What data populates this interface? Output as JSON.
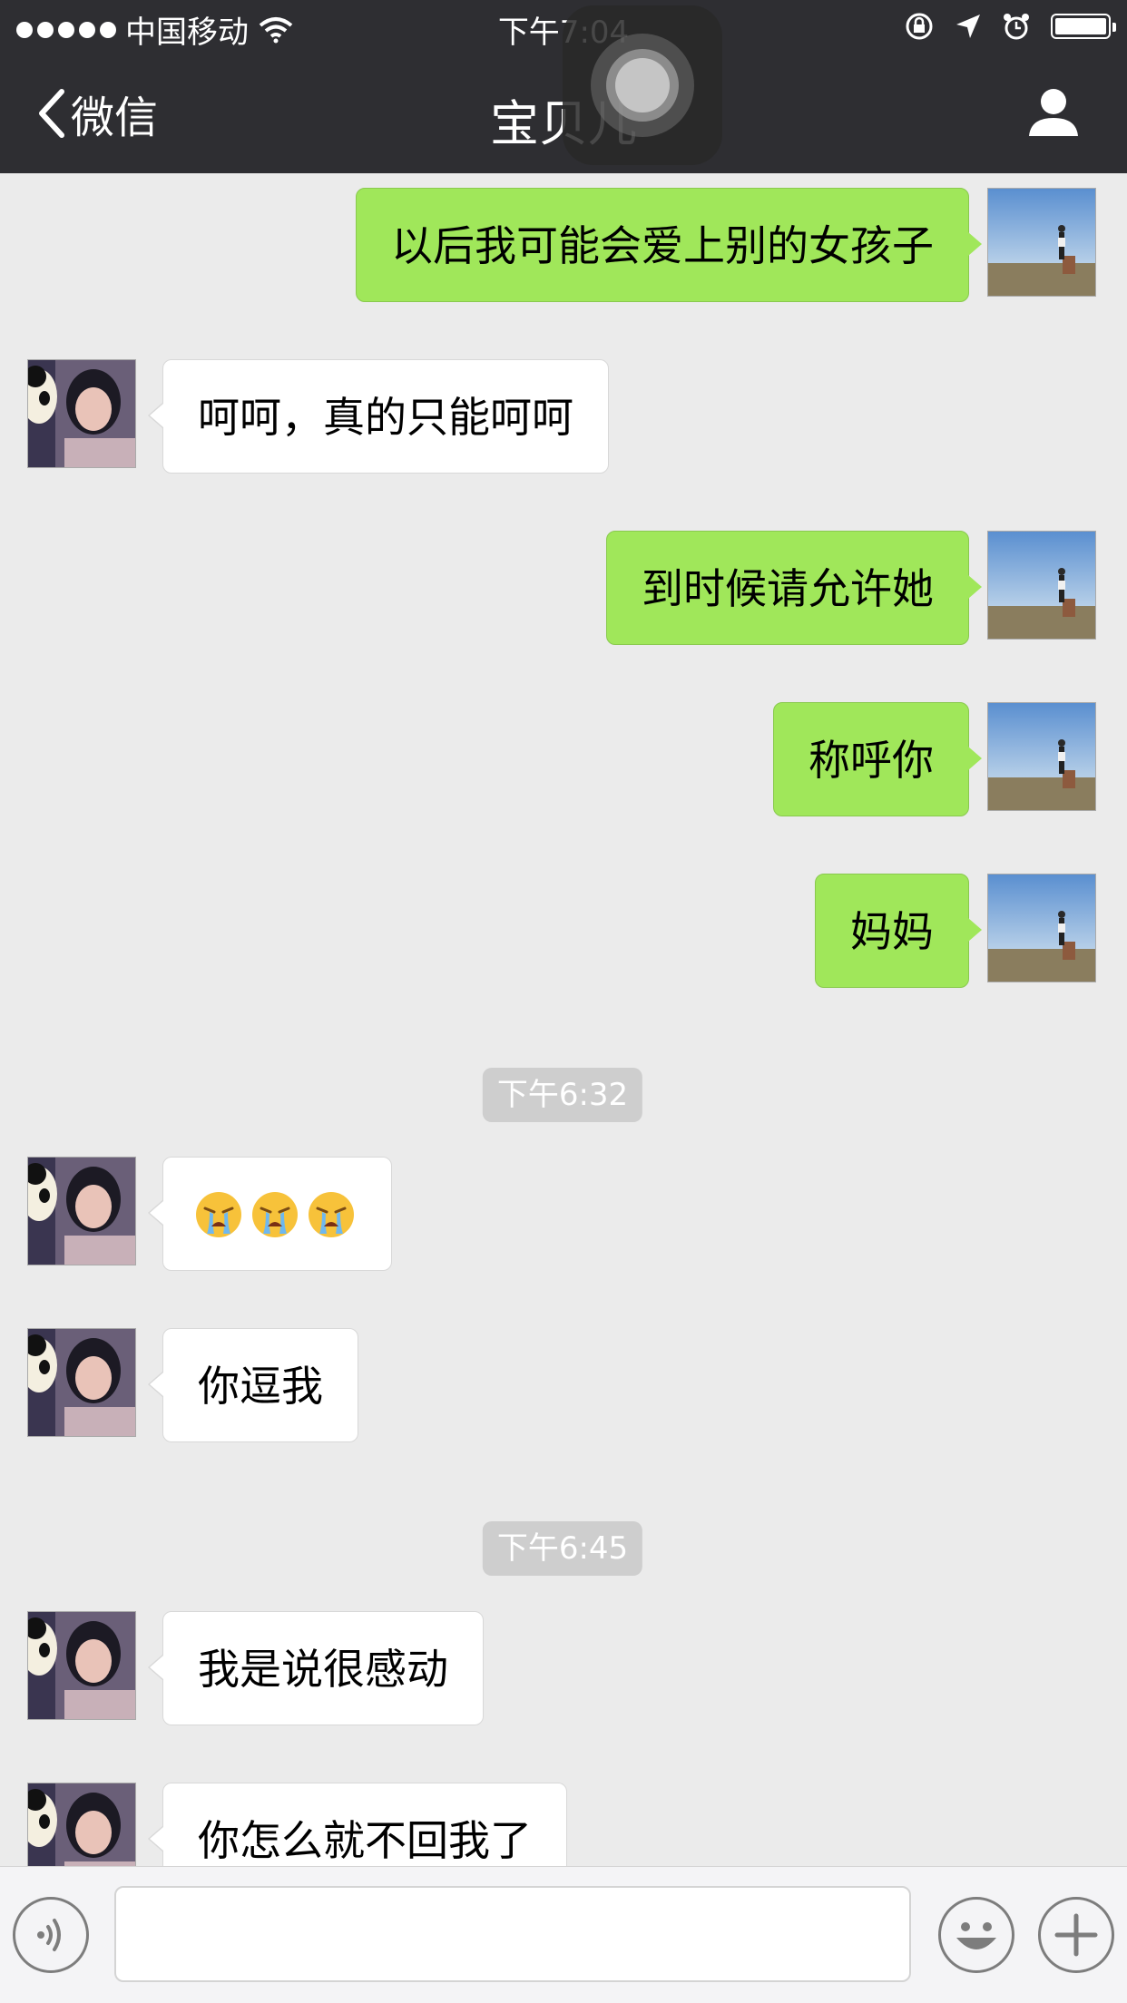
{
  "status_bar": {
    "carrier": "中国移动",
    "time": "下午7:04"
  },
  "nav": {
    "back_label": "微信",
    "title": "宝贝儿"
  },
  "colors": {
    "nav_bg": "#2e2e32",
    "chat_bg": "#ebebeb",
    "sent_bubble": "#a0e75a",
    "received_bubble": "#ffffff",
    "timestamp_bg": "#cecece"
  },
  "messages": [
    {
      "direction": "out",
      "text": "以后我可能会爱上别的女孩子"
    },
    {
      "direction": "in",
      "text": "呵呵，真的只能呵呵"
    },
    {
      "direction": "out",
      "text": "到时候请允许她"
    },
    {
      "direction": "out",
      "text": "称呼你"
    },
    {
      "direction": "out",
      "text": "妈妈"
    },
    {
      "type": "timestamp",
      "text": "下午6:32"
    },
    {
      "direction": "in",
      "emoji": [
        "crying-face",
        "crying-face",
        "crying-face"
      ]
    },
    {
      "direction": "in",
      "text": "你逗我"
    },
    {
      "type": "timestamp",
      "text": "下午6:45"
    },
    {
      "direction": "in",
      "text": "我是说很感动"
    },
    {
      "direction": "in",
      "text": "你怎么就不回我了"
    }
  ],
  "input_bar": {
    "voice_icon": "voice-icon",
    "emoji_icon": "smiley-icon",
    "more_icon": "plus-icon",
    "message_value": ""
  }
}
